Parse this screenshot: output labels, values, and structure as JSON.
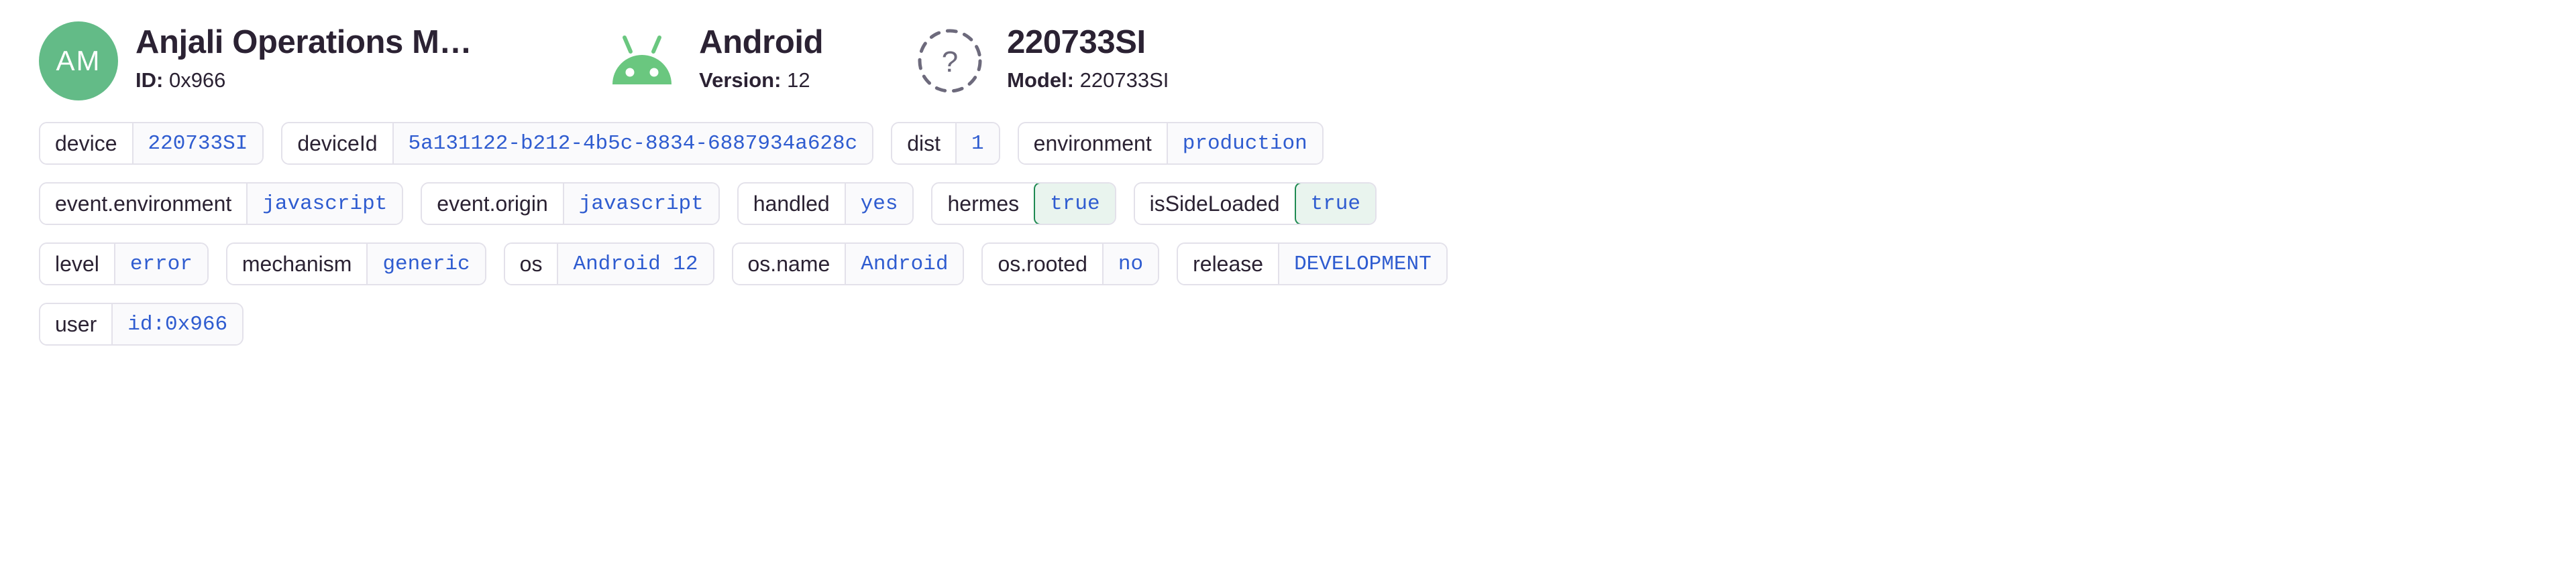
{
  "colors": {
    "avatar_bg": "#63bb87",
    "android_green": "#6ac77f",
    "unknown_gray": "#6d6a7c",
    "value_blue": "#2f5cd0",
    "highlight_border": "#1f8a52",
    "highlight_bg": "#e9f4ee",
    "pill_border": "#e3e1ea",
    "text_dark": "#2b2233"
  },
  "header": {
    "user": {
      "icon": "avatar-initials",
      "initials": "AM",
      "title": "Anjali Operations M…",
      "sub_key": "ID:",
      "sub_value": "0x966"
    },
    "os": {
      "icon": "android-robot-icon",
      "title": "Android",
      "sub_key": "Version:",
      "sub_value": "12"
    },
    "model": {
      "icon": "unknown-device-icon",
      "title": "220733SI",
      "sub_key": "Model:",
      "sub_value": "220733SI"
    }
  },
  "tags": {
    "rows": [
      [
        {
          "key": "device",
          "value": "220733SI",
          "highlighted": false
        },
        {
          "key": "deviceId",
          "value": "5a131122-b212-4b5c-8834-6887934a628c",
          "highlighted": false
        },
        {
          "key": "dist",
          "value": "1",
          "highlighted": false
        },
        {
          "key": "environment",
          "value": "production",
          "highlighted": false
        }
      ],
      [
        {
          "key": "event.environment",
          "value": "javascript",
          "highlighted": false
        },
        {
          "key": "event.origin",
          "value": "javascript",
          "highlighted": false
        },
        {
          "key": "handled",
          "value": "yes",
          "highlighted": false
        },
        {
          "key": "hermes",
          "value": "true",
          "highlighted": true
        },
        {
          "key": "isSideLoaded",
          "value": "true",
          "highlighted": true
        }
      ],
      [
        {
          "key": "level",
          "value": "error",
          "highlighted": false
        },
        {
          "key": "mechanism",
          "value": "generic",
          "highlighted": false
        },
        {
          "key": "os",
          "value": "Android 12",
          "highlighted": false
        },
        {
          "key": "os.name",
          "value": "Android",
          "highlighted": false
        },
        {
          "key": "os.rooted",
          "value": "no",
          "highlighted": false
        },
        {
          "key": "release",
          "value": "DEVELOPMENT",
          "highlighted": false
        }
      ],
      [
        {
          "key": "user",
          "value": "id:0x966",
          "highlighted": false
        }
      ]
    ]
  }
}
